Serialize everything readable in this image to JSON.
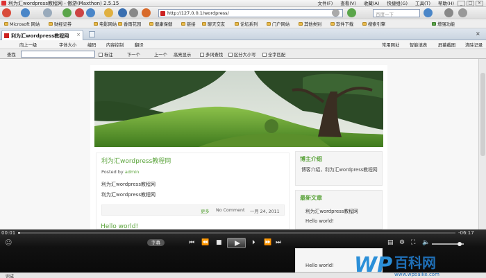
{
  "window": {
    "title": "利为汇wordpress教程网 - 傲游(Maxthon) 2.5.15",
    "menus": [
      "文件(F)",
      "查看(V)",
      "收藏(A)",
      "快捷组(G)",
      "工具(T)",
      "帮助(H)"
    ]
  },
  "toolbar": {
    "url": "http://127.0.0.1/wordpress/",
    "search_placeholder": "百度一下"
  },
  "bookmarks": [
    "Microsoft 网站",
    "财经证券",
    "电影网站",
    "香雨花园",
    "健康保健",
    "链接",
    "聊天交友",
    "论坛系列",
    "门户网站",
    "其他类别",
    "软件下载",
    "搜索引擎",
    "增强功能"
  ],
  "tab": {
    "label": "利为汇wordpress教程网",
    "close": "×"
  },
  "tools": {
    "left": [
      "向上一级",
      "字体大小",
      "编码",
      "内容控制",
      "翻译"
    ],
    "right": [
      "常用网址",
      "智能填表",
      "屏幕截图",
      "清除记录"
    ]
  },
  "findbar": {
    "label": "查找",
    "mark": "标注",
    "next": "下一个",
    "prev": "上一个",
    "highlight": "高亮显示",
    "multi": "多词查找",
    "case": "区分大小写",
    "whole": "全字匹配"
  },
  "post": {
    "title": "利为汇wordpress教程网",
    "posted_by": "Posted by",
    "author": "admin",
    "p1": "利为汇wordpress教程网",
    "p2": "利为汇wordpress教程网",
    "more": "更多",
    "comments": "No Comment",
    "date": "一月 24, 2011"
  },
  "post2": {
    "title": "Hello world!"
  },
  "sidebar": {
    "bio_title": "博主介绍",
    "bio": "博客介绍，利为汇wordpress教程网",
    "recent_title": "最新文章",
    "recent": [
      "利为汇wordpress教程网",
      "Hello world!"
    ],
    "recent2": [
      "Hello world!"
    ]
  },
  "player": {
    "elapsed": "00:01",
    "remaining": "-06:17",
    "subtitle": "字幕",
    "progress": 0.005,
    "volume": 0.87
  },
  "status": {
    "text": "完成"
  },
  "watermark": {
    "brand": "百科网",
    "url": "www.wpbaike.com"
  }
}
